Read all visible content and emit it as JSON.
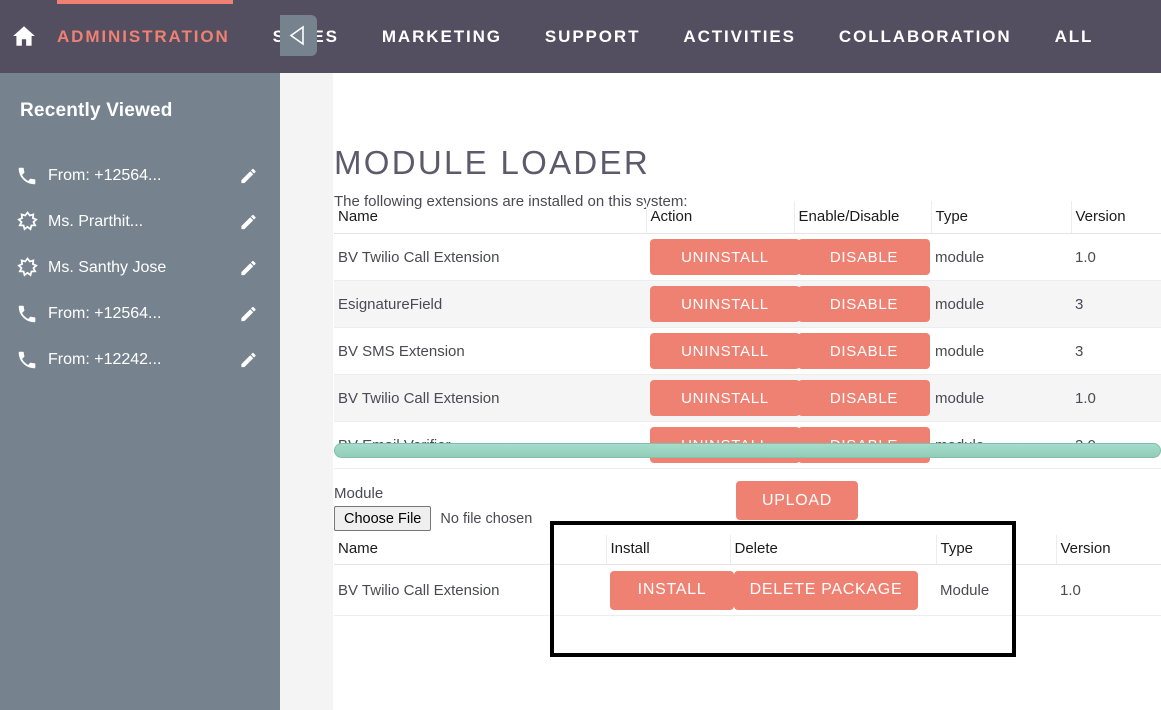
{
  "topnav": {
    "home_icon": "home-icon",
    "items": [
      {
        "label": "ADMINISTRATION",
        "active": true
      },
      {
        "label": "SALES",
        "active": false
      },
      {
        "label": "MARKETING",
        "active": false
      },
      {
        "label": "SUPPORT",
        "active": false
      },
      {
        "label": "ACTIVITIES",
        "active": false
      },
      {
        "label": "COLLABORATION",
        "active": false
      },
      {
        "label": "ALL",
        "active": false
      }
    ],
    "background_color": "#544f60",
    "accent_color": "#ef8172"
  },
  "sidebar": {
    "title": "Recently Viewed",
    "background_color": "#76838f",
    "collapse_icon": "triangle-left-icon",
    "items": [
      {
        "icon": "phone-icon",
        "label": "From: +12564...",
        "edit_icon": "pencil-icon"
      },
      {
        "icon": "contact-star-icon",
        "label": "Ms. Prarthit...",
        "edit_icon": "pencil-icon"
      },
      {
        "icon": "contact-star-icon",
        "label": "Ms. Santhy Jose",
        "edit_icon": "pencil-icon"
      },
      {
        "icon": "phone-icon",
        "label": "From: +12564...",
        "edit_icon": "pencil-icon"
      },
      {
        "icon": "phone-icon",
        "label": "From: +12242...",
        "edit_icon": "pencil-icon"
      }
    ]
  },
  "main": {
    "page_title": "MODULE LOADER",
    "intro_text": "The following extensions are installed on this system:",
    "installed_table": {
      "columns": [
        "Name",
        "Action",
        "Enable/Disable",
        "Type",
        "Version"
      ],
      "uninstall_label": "UNINSTALL",
      "disable_label": "DISABLE",
      "rows": [
        {
          "name": "BV Twilio Call Extension",
          "action": "UNINSTALL",
          "enable": "DISABLE",
          "type": "module",
          "version": "1.0"
        },
        {
          "name": "EsignatureField",
          "action": "UNINSTALL",
          "enable": "DISABLE",
          "type": "module",
          "version": "3"
        },
        {
          "name": "BV SMS Extension",
          "action": "UNINSTALL",
          "enable": "DISABLE",
          "type": "module",
          "version": "3"
        },
        {
          "name": "BV Twilio Call Extension",
          "action": "UNINSTALL",
          "enable": "DISABLE",
          "type": "module",
          "version": "1.0"
        },
        {
          "name": "BV Email Verifier",
          "action": "UNINSTALL",
          "enable": "DISABLE",
          "type": "module",
          "version": "2.0"
        }
      ]
    },
    "scrollbar": {
      "orientation": "horizontal",
      "color": "#97d1bd"
    },
    "upload": {
      "module_label": "Module",
      "choose_file_label": "Choose File",
      "no_file_label": "No file chosen",
      "upload_label": "UPLOAD"
    },
    "package_table": {
      "columns": [
        "Name",
        "Install",
        "Delete",
        "Type",
        "Version"
      ],
      "rows": [
        {
          "name": "BV Twilio Call Extension",
          "install": "INSTALL",
          "delete": "DELETE PACKAGE",
          "type": "Module",
          "version": "1.0"
        }
      ]
    },
    "highlight_box": {
      "color": "#000000"
    }
  }
}
